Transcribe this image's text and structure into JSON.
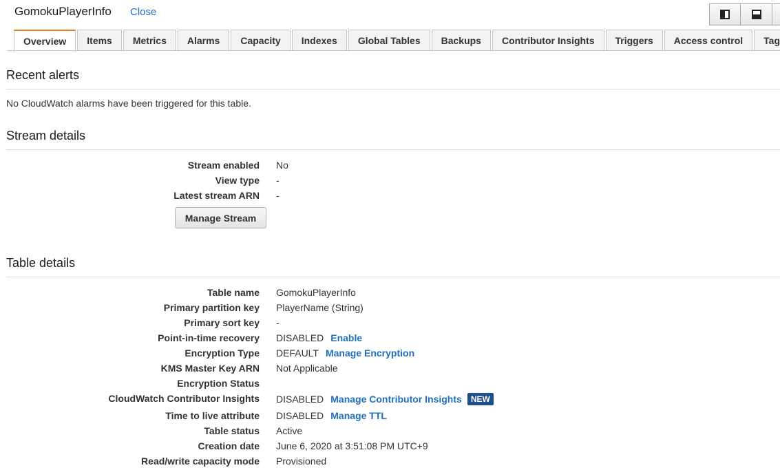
{
  "header": {
    "table_name": "GomokuPlayerInfo",
    "close_label": "Close"
  },
  "tabs": [
    {
      "label": "Overview",
      "active": true
    },
    {
      "label": "Items"
    },
    {
      "label": "Metrics"
    },
    {
      "label": "Alarms"
    },
    {
      "label": "Capacity"
    },
    {
      "label": "Indexes"
    },
    {
      "label": "Global Tables"
    },
    {
      "label": "Backups"
    },
    {
      "label": "Contributor Insights"
    },
    {
      "label": "Triggers"
    },
    {
      "label": "Access control"
    },
    {
      "label": "Tags"
    }
  ],
  "recent_alerts": {
    "title": "Recent alerts",
    "message": "No CloudWatch alarms have been triggered for this table."
  },
  "stream_details": {
    "title": "Stream details",
    "rows": [
      {
        "label": "Stream enabled",
        "value": "No"
      },
      {
        "label": "View type",
        "value": "-"
      },
      {
        "label": "Latest stream ARN",
        "value": "-"
      }
    ],
    "manage_button": "Manage Stream"
  },
  "table_details": {
    "title": "Table details",
    "rows": [
      {
        "label": "Table name",
        "value": "GomokuPlayerInfo"
      },
      {
        "label": "Primary partition key",
        "value": "PlayerName (String)"
      },
      {
        "label": "Primary sort key",
        "value": "-"
      },
      {
        "label": "Point-in-time recovery",
        "value": "DISABLED",
        "link": "Enable"
      },
      {
        "label": "Encryption Type",
        "value": "DEFAULT",
        "link": "Manage Encryption"
      },
      {
        "label": "KMS Master Key ARN",
        "value": "Not Applicable"
      },
      {
        "label": "Encryption Status",
        "value": ""
      },
      {
        "label": "CloudWatch Contributor Insights",
        "value": "DISABLED",
        "link": "Manage Contributor Insights",
        "badge": "NEW"
      },
      {
        "label": "Time to live attribute",
        "value": "DISABLED",
        "link": "Manage TTL"
      },
      {
        "label": "Table status",
        "value": "Active"
      },
      {
        "label": "Creation date",
        "value": "June 6, 2020 at 3:51:08 PM UTC+9"
      },
      {
        "label": "Read/write capacity mode",
        "value": "Provisioned"
      }
    ]
  },
  "colors": {
    "link": "#1f6fbe",
    "active_tab_accent": "#e67e22",
    "badge_bg": "#1f4e8c"
  }
}
